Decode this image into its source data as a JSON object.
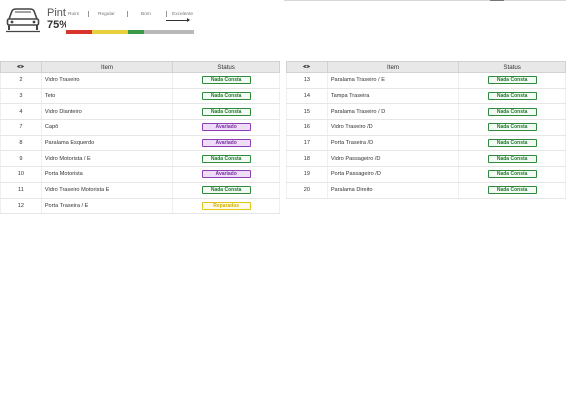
{
  "header": {
    "title": "Pintu",
    "percent": "75%",
    "icon": "car-front-icon",
    "scale_labels": [
      "Ruim",
      "Regular",
      "Bom",
      "Excelente"
    ],
    "scale_segments": [
      {
        "color": "#d9342b"
      },
      {
        "color": "#e8d03a"
      },
      {
        "color": "#3a9a4a"
      }
    ]
  },
  "columns": {
    "eye_icon": "eye-icon",
    "item": "Item",
    "status": "Status"
  },
  "status_colors": {
    "Nada Consta": {
      "border": "#2e8b3e",
      "text": "#1f7a2f",
      "bg": "#f4fbf4"
    },
    "Avariado": {
      "border": "#8e3fb5",
      "text": "#7d2fa6",
      "bg": "#eeddf6"
    },
    "Reparados": {
      "border": "#e0c51a",
      "text": "#d0b300",
      "bg": "#fffbe6"
    }
  },
  "left_table": [
    {
      "num": "2",
      "item": "Vidro Traseiro",
      "status": "Nada Consta"
    },
    {
      "num": "3",
      "item": "Teto",
      "status": "Nada Consta"
    },
    {
      "num": "4",
      "item": "Vidro Dianteiro",
      "status": "Nada Consta"
    },
    {
      "num": "7",
      "item": "Capô",
      "status": "Avariado"
    },
    {
      "num": "8",
      "item": "Paralama Esquerdo",
      "status": "Avariado"
    },
    {
      "num": "9",
      "item": "Vidro Motorista / E",
      "status": "Nada Consta"
    },
    {
      "num": "10",
      "item": "Porta Motorista",
      "status": "Avariado"
    },
    {
      "num": "11",
      "item": "Vidro Traseiro Motorista E",
      "status": "Nada Consta"
    },
    {
      "num": "12",
      "item": "Porta Traseira / E",
      "status": "Reparados"
    }
  ],
  "right_table": [
    {
      "num": "13",
      "item": "Paralama Traseiro / E",
      "status": "Nada Consta"
    },
    {
      "num": "14",
      "item": "Tampa Traseira",
      "status": "Nada Consta"
    },
    {
      "num": "15",
      "item": "Paralama Traseiro / D",
      "status": "Nada Consta"
    },
    {
      "num": "16",
      "item": "Vidro Traseiro /D",
      "status": "Nada Consta"
    },
    {
      "num": "17",
      "item": "Porta Traseira /D",
      "status": "Nada Consta"
    },
    {
      "num": "18",
      "item": "Vidro Passageiro /D",
      "status": "Nada Consta"
    },
    {
      "num": "19",
      "item": "Porta Passageiro /D",
      "status": "Nada Consta"
    },
    {
      "num": "20",
      "item": "Paralama Direito",
      "status": "Nada Consta"
    }
  ]
}
